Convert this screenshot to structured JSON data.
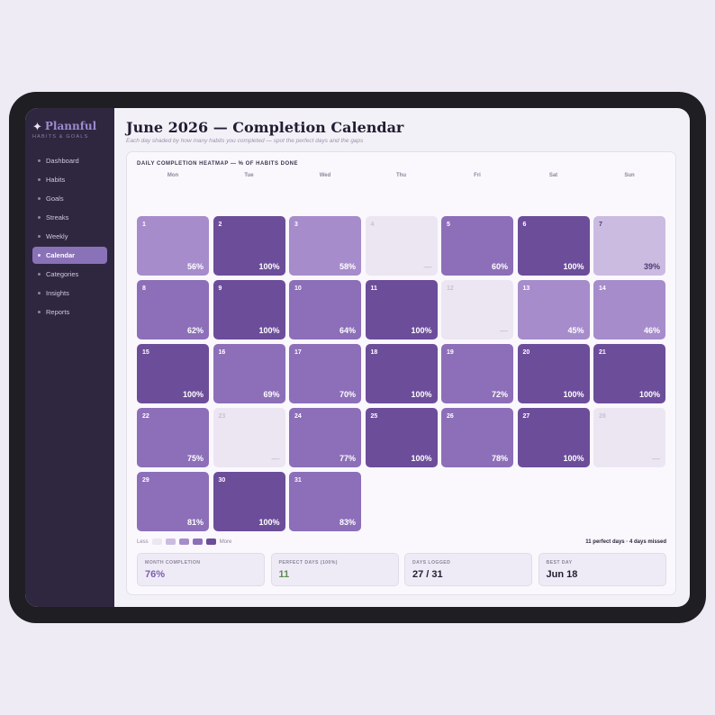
{
  "app": {
    "name": "Plannful",
    "tagline": "HABITS & GOALS"
  },
  "nav": [
    {
      "label": "Dashboard",
      "active": false
    },
    {
      "label": "Habits",
      "active": false
    },
    {
      "label": "Goals",
      "active": false
    },
    {
      "label": "Streaks",
      "active": false
    },
    {
      "label": "Weekly",
      "active": false
    },
    {
      "label": "Calendar",
      "active": true
    },
    {
      "label": "Categories",
      "active": false
    },
    {
      "label": "Insights",
      "active": false
    },
    {
      "label": "Reports",
      "active": false
    }
  ],
  "page": {
    "title": "June 2026 — Completion Calendar",
    "subtitle": "Each day shaded by how many habits you completed — spot the perfect days and the gaps"
  },
  "heatmap": {
    "title": "DAILY COMPLETION HEATMAP — % OF HABITS DONE",
    "weekdays": [
      "Mon",
      "Tue",
      "Wed",
      "Thu",
      "Fri",
      "Sat",
      "Sun"
    ],
    "days": [
      {
        "day": "1",
        "pct": "56%",
        "level": 2
      },
      {
        "day": "2",
        "pct": "100%",
        "level": 4
      },
      {
        "day": "3",
        "pct": "58%",
        "level": 2
      },
      {
        "day": "4",
        "pct": "—",
        "level": 0
      },
      {
        "day": "5",
        "pct": "60%",
        "level": 3
      },
      {
        "day": "6",
        "pct": "100%",
        "level": 4
      },
      {
        "day": "7",
        "pct": "39%",
        "level": 1
      },
      {
        "day": "8",
        "pct": "62%",
        "level": 3
      },
      {
        "day": "9",
        "pct": "100%",
        "level": 4
      },
      {
        "day": "10",
        "pct": "64%",
        "level": 3
      },
      {
        "day": "11",
        "pct": "100%",
        "level": 4
      },
      {
        "day": "12",
        "pct": "—",
        "level": 0
      },
      {
        "day": "13",
        "pct": "45%",
        "level": 2
      },
      {
        "day": "14",
        "pct": "46%",
        "level": 2
      },
      {
        "day": "15",
        "pct": "100%",
        "level": 4
      },
      {
        "day": "16",
        "pct": "69%",
        "level": 3
      },
      {
        "day": "17",
        "pct": "70%",
        "level": 3
      },
      {
        "day": "18",
        "pct": "100%",
        "level": 4
      },
      {
        "day": "19",
        "pct": "72%",
        "level": 3
      },
      {
        "day": "20",
        "pct": "100%",
        "level": 4
      },
      {
        "day": "21",
        "pct": "100%",
        "level": 4
      },
      {
        "day": "22",
        "pct": "75%",
        "level": 3
      },
      {
        "day": "23",
        "pct": "—",
        "level": 0
      },
      {
        "day": "24",
        "pct": "77%",
        "level": 3
      },
      {
        "day": "25",
        "pct": "100%",
        "level": 4
      },
      {
        "day": "26",
        "pct": "78%",
        "level": 3
      },
      {
        "day": "27",
        "pct": "100%",
        "level": 4
      },
      {
        "day": "28",
        "pct": "—",
        "level": 0
      },
      {
        "day": "29",
        "pct": "81%",
        "level": 3
      },
      {
        "day": "30",
        "pct": "100%",
        "level": 4
      },
      {
        "day": "31",
        "pct": "83%",
        "level": 3
      }
    ],
    "legend": {
      "less": "Less",
      "more": "More",
      "colors": [
        "#ece6f3",
        "#cbbbe1",
        "#a68ccb",
        "#8c6fb8",
        "#6c4d9a"
      ]
    },
    "summary": "11 perfect days · 4 days missed"
  },
  "stats": [
    {
      "label": "MONTH COMPLETION",
      "value": "76%",
      "color": "#7d5fb0"
    },
    {
      "label": "PERFECT DAYS (100%)",
      "value": "11",
      "color": "#5f8a55"
    },
    {
      "label": "DAYS LOGGED",
      "value": "27 / 31",
      "color": "#231d33"
    },
    {
      "label": "BEST DAY",
      "value": "Jun 18",
      "color": "#231d33"
    }
  ],
  "colors": {
    "accent": "#8a72b8",
    "sidebar": "#2f2740"
  }
}
